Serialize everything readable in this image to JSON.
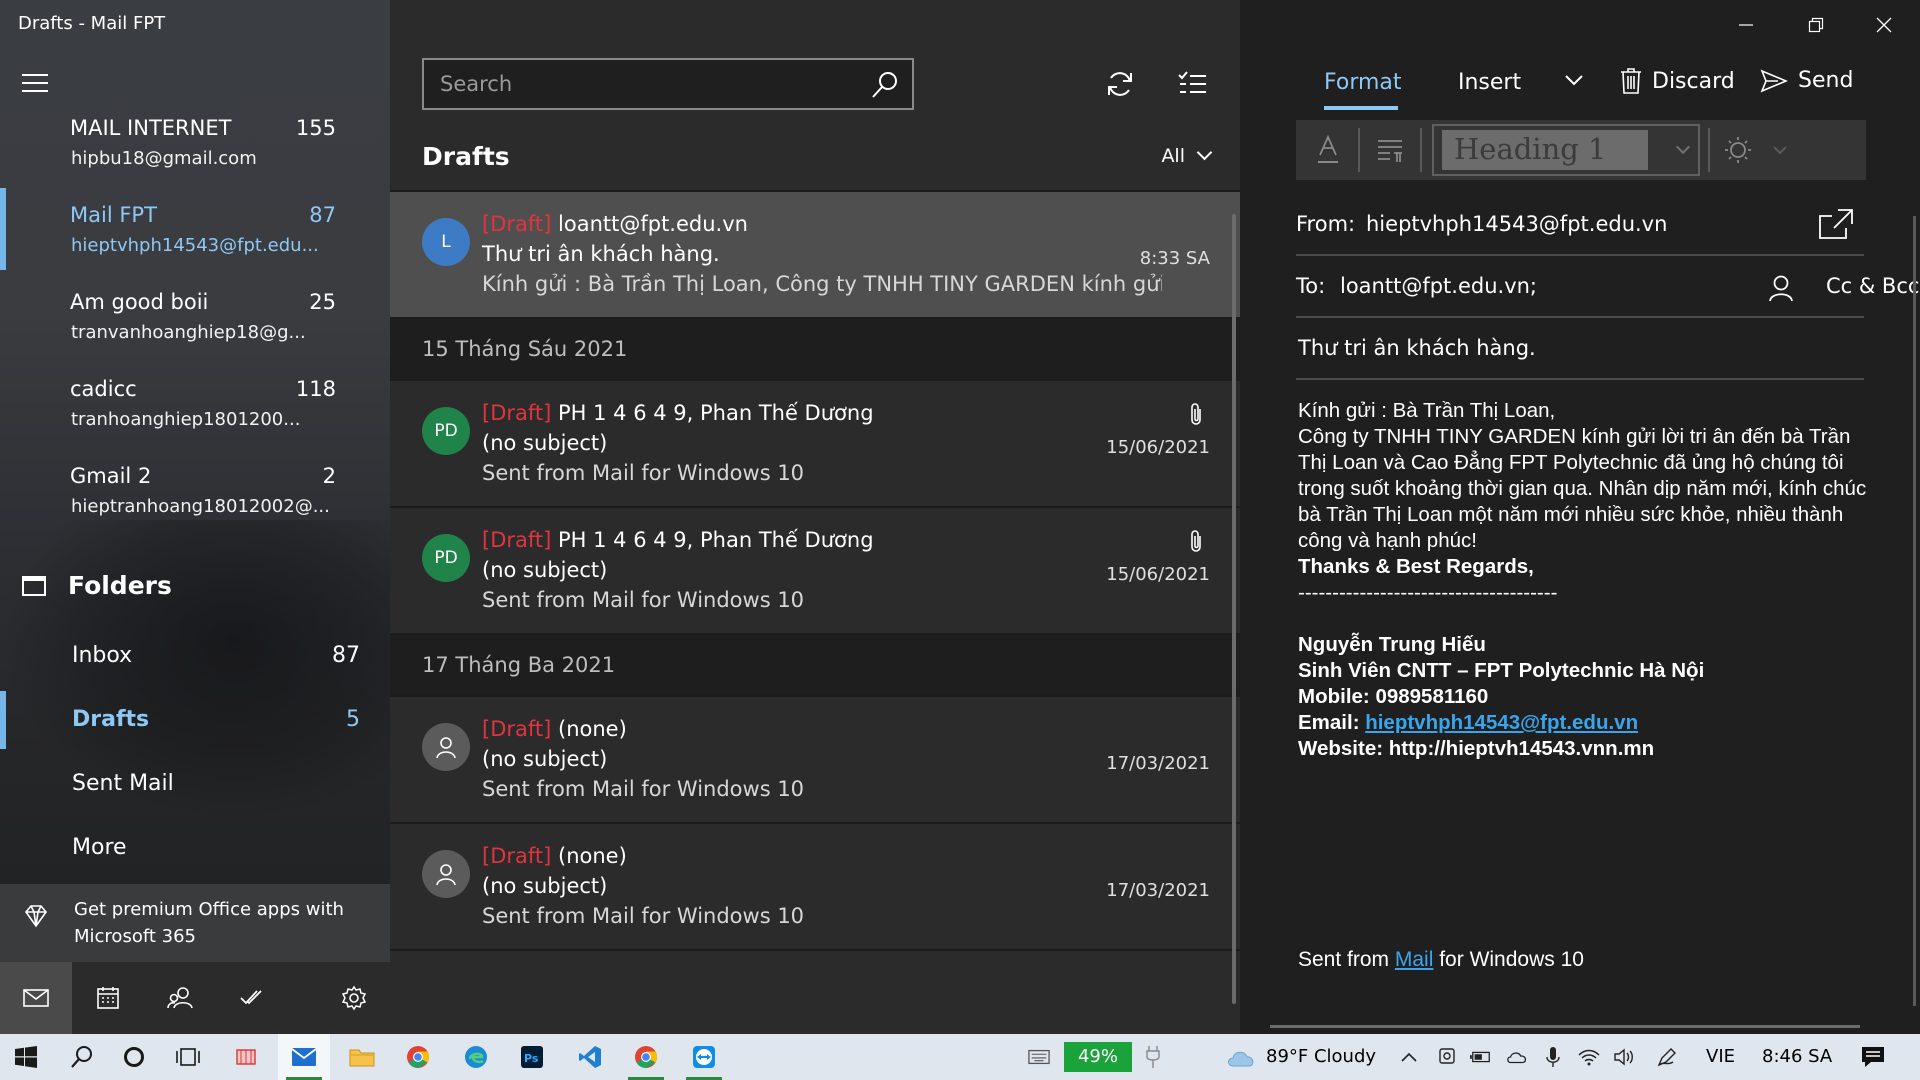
{
  "window": {
    "title": "Drafts - Mail FPT"
  },
  "accounts": [
    {
      "name": "MAIL INTERNET",
      "count": "155",
      "email": "hipbu18@gmail.com",
      "active": false
    },
    {
      "name": "Mail FPT",
      "count": "87",
      "email": "hieptvhph14543@fpt.edu...",
      "active": true
    },
    {
      "name": "Am good boii",
      "count": "25",
      "email": "tranvanhoanghiep18@g...",
      "active": false
    },
    {
      "name": "cadicc",
      "count": "118",
      "email": "tranhoanghiep1801200...",
      "active": false
    },
    {
      "name": "Gmail 2",
      "count": "2",
      "email": "hieptranhoang18012002@...",
      "active": false
    }
  ],
  "folders": {
    "heading": "Folders",
    "items": [
      {
        "label": "Inbox",
        "count": "87"
      },
      {
        "label": "Drafts",
        "count": "5"
      },
      {
        "label": "Sent Mail",
        "count": ""
      },
      {
        "label": "More",
        "count": ""
      }
    ]
  },
  "premium": {
    "text": "Get premium Office apps with Microsoft 365"
  },
  "middle": {
    "search_placeholder": "Search",
    "list_title": "Drafts",
    "filter": "All",
    "draft_tag": "[Draft]",
    "messages": [
      {
        "avatar": "L",
        "avatar_color": "#3d7cc4",
        "sender": "loantt@fpt.edu.vn",
        "subject": "Thư tri ân khách hàng.",
        "preview": "Kính gửi : Bà Trần Thị Loan, Công ty TNHH TINY GARDEN kính gửi",
        "time": "8:33 SA",
        "attachment": false
      },
      {
        "avatar": "PD",
        "avatar_color": "#20834a",
        "sender": "PH 1 4 6 4 9, Phan Thế Dương",
        "subject": "(no subject)",
        "preview": "Sent from Mail for Windows 10",
        "time": "15/06/2021",
        "attachment": true
      },
      {
        "avatar": "PD",
        "avatar_color": "#20834a",
        "sender": "PH 1 4 6 4 9, Phan Thế Dương",
        "subject": "(no subject)",
        "preview": "Sent from Mail for Windows 10",
        "time": "15/06/2021",
        "attachment": true
      },
      {
        "avatar": "person-icon",
        "avatar_color": "#5b5b5b",
        "sender": "(none)",
        "subject": "(no subject)",
        "preview": "Sent from Mail for Windows 10",
        "time": "17/03/2021",
        "attachment": false
      },
      {
        "avatar": "person-icon",
        "avatar_color": "#5b5b5b",
        "sender": "(none)",
        "subject": "(no subject)",
        "preview": "Sent from Mail for Windows 10",
        "time": "17/03/2021",
        "attachment": false
      }
    ],
    "date_headers": [
      "15 Tháng Sáu 2021",
      "17 Tháng Ba 2021"
    ]
  },
  "compose": {
    "tabs": {
      "format": "Format",
      "insert": "Insert"
    },
    "discard": "Discard",
    "send": "Send",
    "style_select": "Heading 1",
    "from_label": "From:",
    "from_value": "hieptvhph14543@fpt.edu.vn",
    "to_label": "To:",
    "to_value": "loantt@fpt.edu.vn;",
    "cc_bcc": "Cc & Bcc",
    "subject": "Thư tri ân khách hàng.",
    "body": {
      "greeting": "Kính gửi : Bà Trần Thị Loan,",
      "paragraph": "Công ty TNHH TINY GARDEN kính gửi lời tri ân đến bà Trần Thị Loan và Cao Đẳng FPT Polytechnic đã ủng hộ chúng tôi trong suốt khoảng thời gian qua. Nhân dịp năm mới, kính chúc bà Trần Thị Loan một năm mới nhiều sức khỏe, nhiều thành công và hạnh phúc!",
      "regards": "Thanks & Best Regards,",
      "rule": "--------------------------------------",
      "name": "Nguyễn Trung Hiếu",
      "title": "Sinh Viên CNTT – FPT Polytechnic Hà Nội",
      "mobile_label": "Mobile: ",
      "mobile": "0989581160",
      "email_label": "Email: ",
      "email": "hieptvhph14543@fpt.edu.vn",
      "website_label": "Website: ",
      "website": "http://hieptvh14543.vnn.mn"
    },
    "signature": {
      "prefix": "Sent from ",
      "link": "Mail",
      "suffix": " for Windows 10"
    }
  },
  "taskbar": {
    "battery": "49%",
    "weather": "89°F  Cloudy",
    "language": "VIE",
    "clock": "8:46 SA"
  },
  "colors": {
    "accent": "#8ec8f5",
    "draft_tag": "#e0353f",
    "link": "#3aa5ec",
    "battery": "#1aa33a"
  }
}
